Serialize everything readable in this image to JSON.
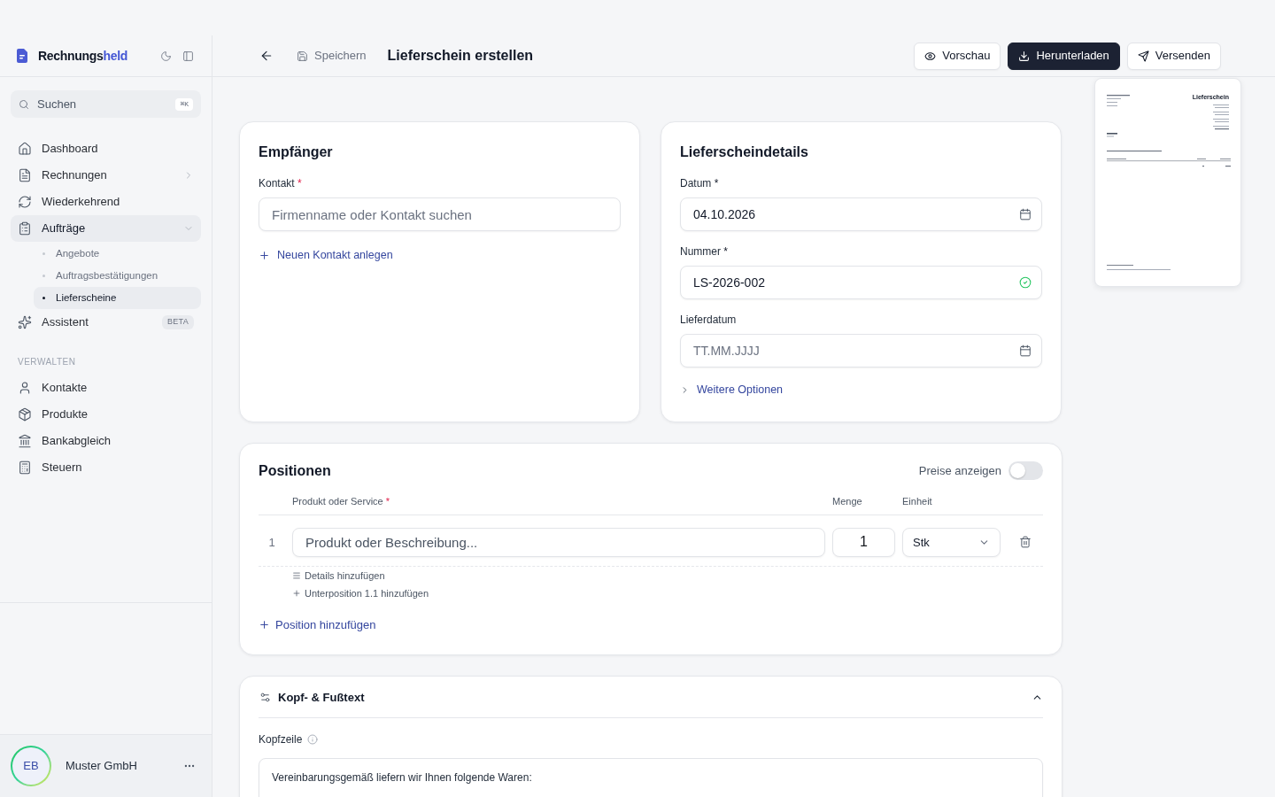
{
  "sidebar": {
    "brand": {
      "name": "Rechnungs",
      "accent": "held"
    },
    "search": {
      "placeholder": "Suchen",
      "shortcut": "⌘K"
    },
    "nav": [
      {
        "label": "Dashboard",
        "selected": false
      },
      {
        "label": "Rechnungen",
        "selected": false,
        "expanded": false
      },
      {
        "label": "Wiederkehrend",
        "selected": false
      },
      {
        "label": "Aufträge",
        "selected": true,
        "expanded": true,
        "children": [
          {
            "label": "Angebote",
            "selected": false
          },
          {
            "label": "Auftragsbestätigungen",
            "selected": false
          },
          {
            "label": "Lieferscheine",
            "selected": true
          }
        ]
      },
      {
        "label": "Assistent",
        "selected": false,
        "badge": "BETA"
      }
    ],
    "manage": {
      "title": "VERWALTEN",
      "items": [
        {
          "label": "Kontakte",
          "selected": false
        },
        {
          "label": "Produkte",
          "selected": false
        },
        {
          "label": "Bankabgleich",
          "selected": false
        },
        {
          "label": "Steuern",
          "selected": false
        }
      ]
    },
    "user": {
      "initials": "EB",
      "name": "Muster GmbH"
    }
  },
  "header": {
    "save": "Speichern",
    "title": "Lieferschein erstellen",
    "actions": [
      {
        "label": "Vorschau",
        "kind": "outline"
      },
      {
        "label": "Herunterladen",
        "kind": "primary"
      },
      {
        "label": "Versenden",
        "kind": "outline"
      }
    ]
  },
  "recipient": {
    "title": "Empfänger",
    "contact": {
      "label": "Kontakt",
      "mark": "*",
      "mark_alert": true,
      "placeholder": "Firmenname oder Kontakt suchen"
    },
    "add_link": "Neuen Kontakt anlegen"
  },
  "details": {
    "title": "Lieferscheindetails",
    "fields": [
      {
        "label": "Datum",
        "mark": "*",
        "mark_alert": false,
        "kind": "date",
        "value": "04.10.2026"
      },
      {
        "label": "Nummer",
        "mark": "*",
        "mark_alert": false,
        "kind": "text",
        "value": "LS-2026-002",
        "valid": true
      },
      {
        "label": "Lieferdatum",
        "kind": "date",
        "placeholder": "TT.MM.JJJJ"
      }
    ],
    "more_link": {
      "label": "Weitere Optionen",
      "expanded": false
    }
  },
  "positions": {
    "title": "Positionen",
    "show_prices": {
      "label": "Preise anzeigen",
      "on": false
    },
    "columns": [
      {
        "label": "Produkt oder Service",
        "mark": "*",
        "mark_alert": true
      },
      {
        "label": "Menge"
      },
      {
        "label": "Einheit"
      }
    ],
    "rows": [
      {
        "number": "1",
        "placeholder": "Produkt oder Beschreibung...",
        "quantity": "1",
        "unit": "Stk",
        "actions": [
          "Details hinzufügen",
          "Unterposition 1.1 hinzufügen"
        ]
      }
    ],
    "add_link": "Position hinzufügen"
  },
  "texts": {
    "title": "Kopf- & Fußtext",
    "expanded": true,
    "header_label": "Kopfzeile",
    "header_value": "Vereinbarungsgemäß liefern wir Ihnen folgende Waren:"
  },
  "preview": {
    "title": "Lieferschein"
  }
}
